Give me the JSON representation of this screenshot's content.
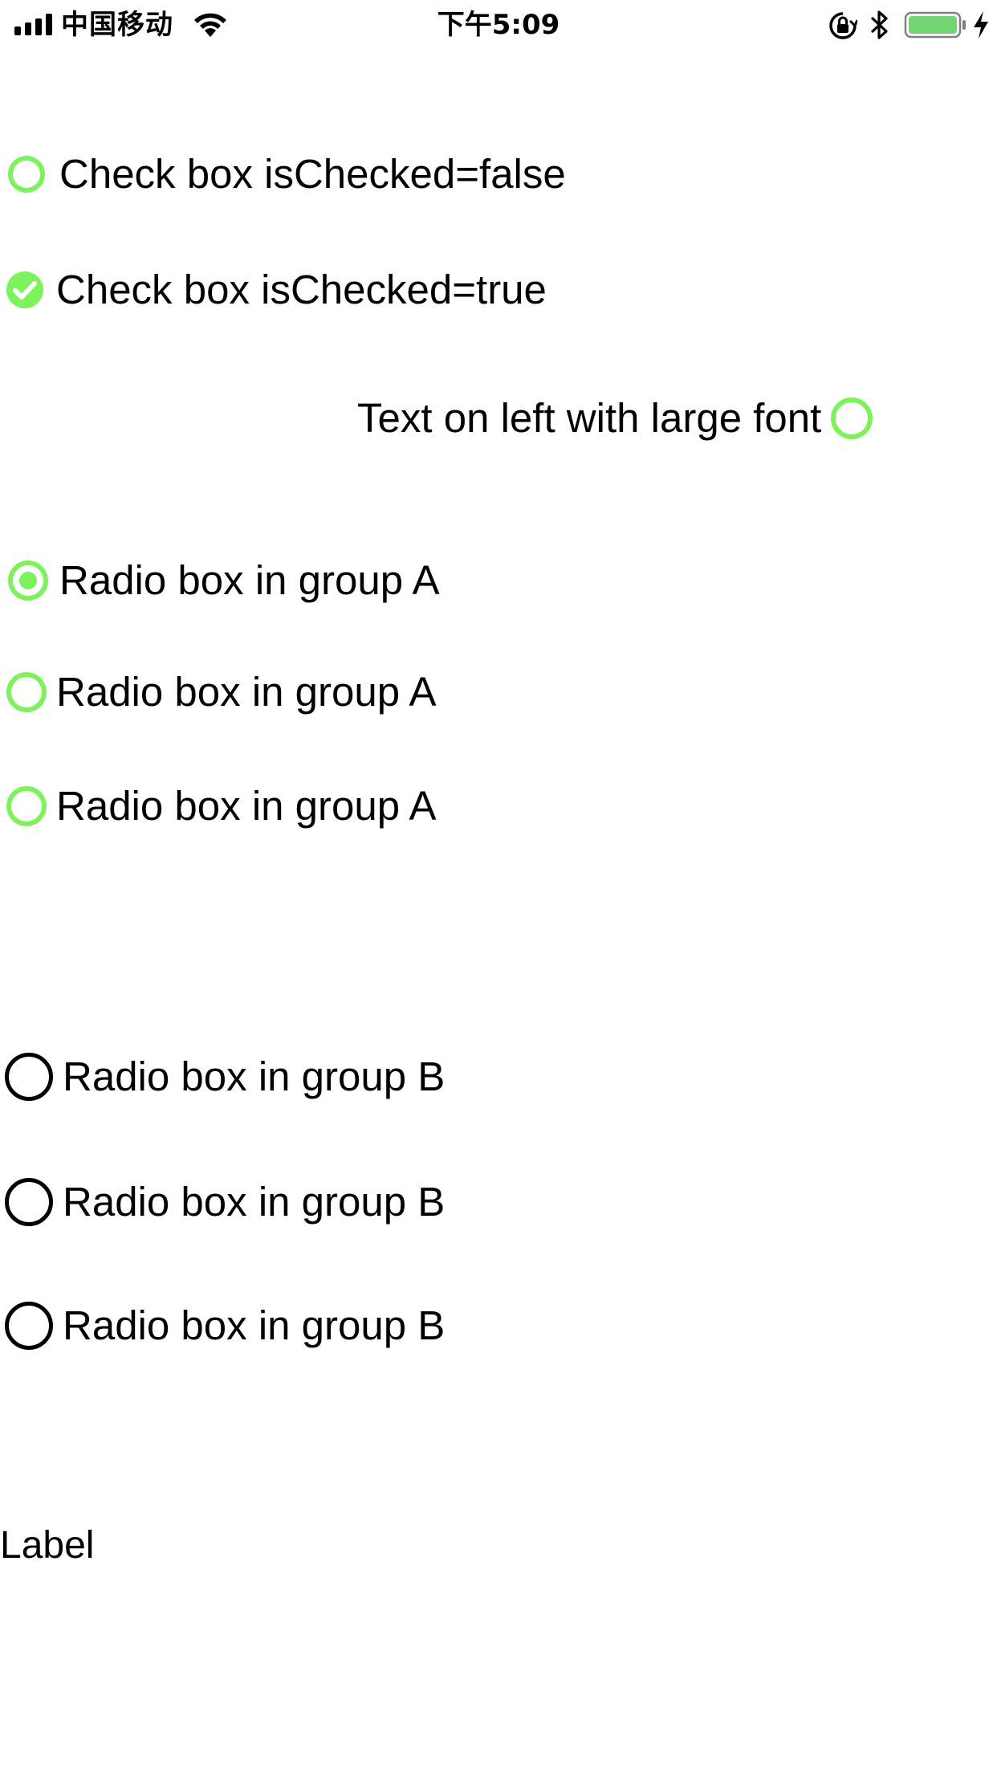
{
  "status_bar": {
    "carrier": "中国移动",
    "time": "下午5:09",
    "battery_color": "#72d572",
    "icons": [
      "signal-icon",
      "wifi-icon",
      "rotation-lock-icon",
      "bluetooth-icon",
      "battery-icon",
      "charging-icon"
    ]
  },
  "colors": {
    "accent": "#7ef25c",
    "ring_black": "#000000"
  },
  "checkboxes": [
    {
      "label": "Check box isChecked=false",
      "checked": false
    },
    {
      "label": "Check box isChecked=true",
      "checked": true
    },
    {
      "label": "Text on left with large font",
      "checked": false
    }
  ],
  "group_a": [
    {
      "label": "Radio box in group A",
      "selected": true
    },
    {
      "label": "Radio box in group A",
      "selected": false
    },
    {
      "label": "Radio box in group A",
      "selected": false
    }
  ],
  "group_b": [
    {
      "label": "Radio box in group B",
      "selected": false
    },
    {
      "label": "Radio box in group B",
      "selected": false
    },
    {
      "label": "Radio box in group B",
      "selected": false
    }
  ],
  "footer": {
    "label": "Label"
  }
}
